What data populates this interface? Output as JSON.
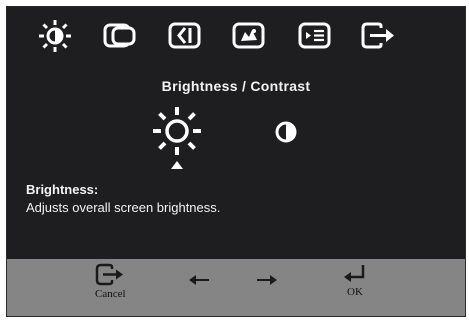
{
  "tabs": [
    {
      "icon": "brightness-sun-icon",
      "selected": true
    },
    {
      "icon": "image-position-icon",
      "selected": false
    },
    {
      "icon": "image-setup-icon",
      "selected": false
    },
    {
      "icon": "image-properties-icon",
      "selected": false
    },
    {
      "icon": "options-icon",
      "selected": false
    },
    {
      "icon": "exit-icon",
      "selected": false
    }
  ],
  "panel": {
    "title": "Brightness / Contrast",
    "options": [
      {
        "icon": "brightness-sun-icon",
        "selected": true
      },
      {
        "icon": "contrast-icon",
        "selected": false
      }
    ]
  },
  "description": {
    "title": "Brightness:",
    "text": "Adjusts overall screen brightness."
  },
  "footer": {
    "cancel_label": "Cancel",
    "ok_label": "OK"
  },
  "colors": {
    "panel_background": "#1e1e20",
    "footer_background": "#858585",
    "icon_color": "#ffffff"
  }
}
